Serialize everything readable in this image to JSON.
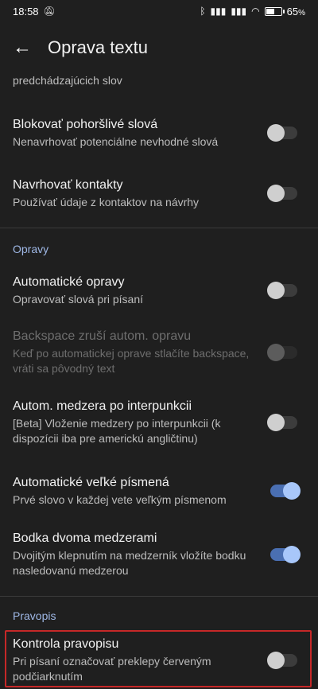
{
  "status_bar": {
    "time": "18:58",
    "battery": "65",
    "battery_unit": "%",
    "icons": [
      "muted-bell-icon",
      "bluetooth-icon",
      "signal-icon",
      "signal-icon",
      "wifi-icon",
      "battery-icon"
    ]
  },
  "header": {
    "title": "Oprava textu",
    "back_icon": "arrow-left-icon"
  },
  "top_partial": {
    "subtitle": "predchádzajúcich slov"
  },
  "items": [
    {
      "id": "block-offensive",
      "title": "Blokovať pohoršlivé slová",
      "subtitle": "Nenavrhovať potenciálne nevhodné slová",
      "enabled": false,
      "disabled": false
    },
    {
      "id": "suggest-contacts",
      "title": "Navrhovať kontakty",
      "subtitle": "Používať údaje z kontaktov na návrhy",
      "enabled": false,
      "disabled": false
    }
  ],
  "sections": {
    "corrections": "Opravy",
    "spellcheck": "Pravopis"
  },
  "corrections_items": [
    {
      "id": "auto-correct",
      "title": "Automatické opravy",
      "subtitle": "Opravovať slová pri písaní",
      "enabled": false,
      "disabled": false
    },
    {
      "id": "backspace-undo",
      "title": "Backspace zruší autom. opravu",
      "subtitle": "Keď po automatickej oprave stlačíte backspace, vráti sa pôvodný text",
      "enabled": false,
      "disabled": true
    },
    {
      "id": "auto-space",
      "title": "Autom. medzera po interpunkcii",
      "subtitle": "[Beta] Vloženie medzery po interpunkcii (k dispozícii iba pre americkú angličtinu)",
      "enabled": false,
      "disabled": false
    },
    {
      "id": "auto-caps",
      "title": "Automatické veľké písmená",
      "subtitle": "Prvé slovo v každej vete veľkým písmenom",
      "enabled": true,
      "disabled": false
    },
    {
      "id": "double-space-period",
      "title": "Bodka dvoma medzerami",
      "subtitle": "Dvojitým klepnutím na medzerník vložíte bodku nasledovanú medzerou",
      "enabled": true,
      "disabled": false
    }
  ],
  "spell_items": [
    {
      "id": "spell-check",
      "title": "Kontrola pravopisu",
      "subtitle": "Pri písaní označovať preklepy červeným podčiarknutím",
      "enabled": false,
      "disabled": false
    }
  ],
  "colors": {
    "background": "#1f1f1f",
    "section_label": "#9fb8e6",
    "toggle_on": "#a8c7fa",
    "highlight": "#c62828"
  }
}
